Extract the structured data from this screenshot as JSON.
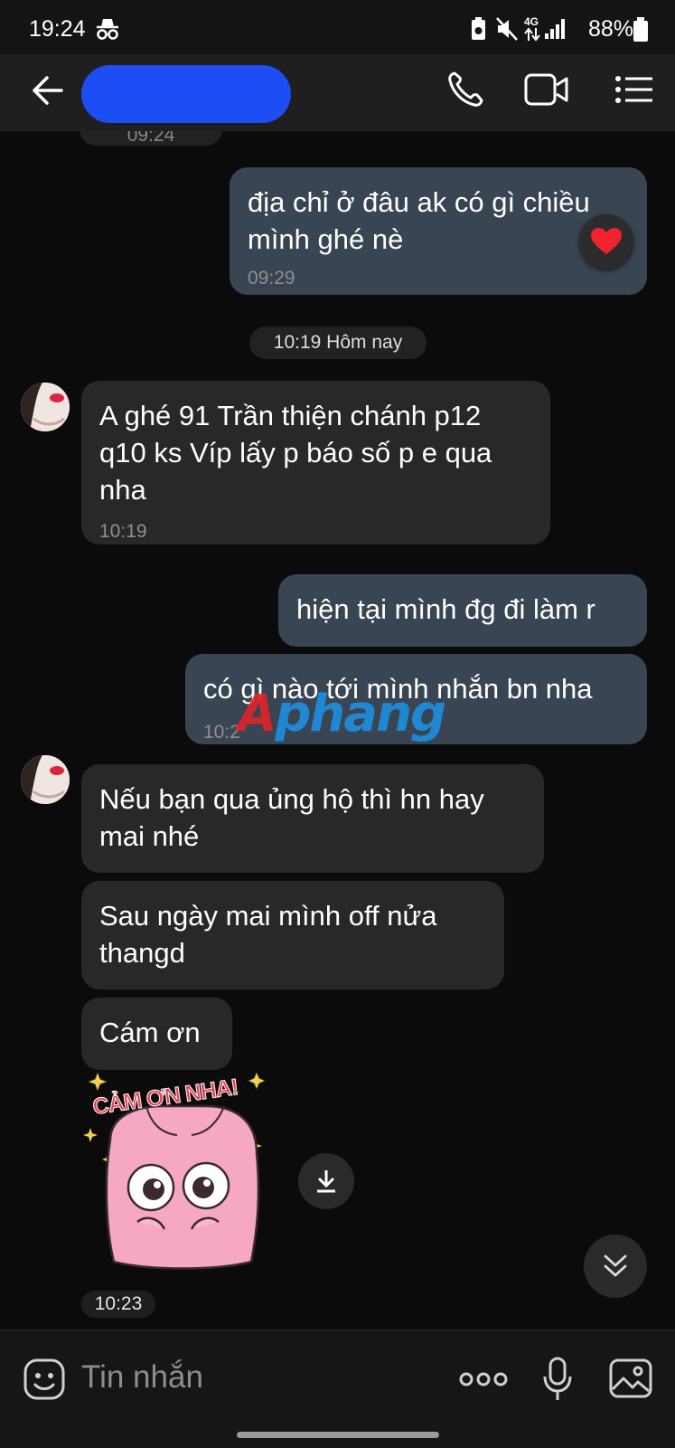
{
  "status_bar": {
    "time": "19:24",
    "network": "4G",
    "battery": "88%"
  },
  "header": {
    "contact_name_redacted": true
  },
  "messages": [
    {
      "text": "địa chỉ ở đâu ak có gì chiều\nmình ghé nè",
      "time": "09:29",
      "reaction": "heart"
    },
    {
      "date_chip": "10:19 Hôm nay"
    },
    {
      "text": "A ghé 91 Trần thiện chánh p12\nq10 ks Víp lấy p báo số p e qua\nnha",
      "time": "10:19"
    },
    {
      "text": "hiện tại mình đg đi làm r"
    },
    {
      "text": "có gì nào tới mình nhắn bn nha",
      "time": "10:2"
    },
    {
      "text": "Nếu bạn qua ủng hộ thì hn hay\nmai nhé"
    },
    {
      "text": " Sau ngày mai mình off nửa\nthangd"
    },
    {
      "text": " Cám ơn"
    },
    {
      "sticker_text": "CẢM ƠN NHA!",
      "time": "10:23"
    }
  ],
  "partial_time_top": "09:24",
  "watermark": "Aphang",
  "input": {
    "placeholder": "Tin nhắn"
  },
  "colors": {
    "background": "#0b0b0b",
    "incoming_bubble": "#282828",
    "outgoing_bubble": "#3a4554",
    "redaction": "#1d4ef5"
  }
}
